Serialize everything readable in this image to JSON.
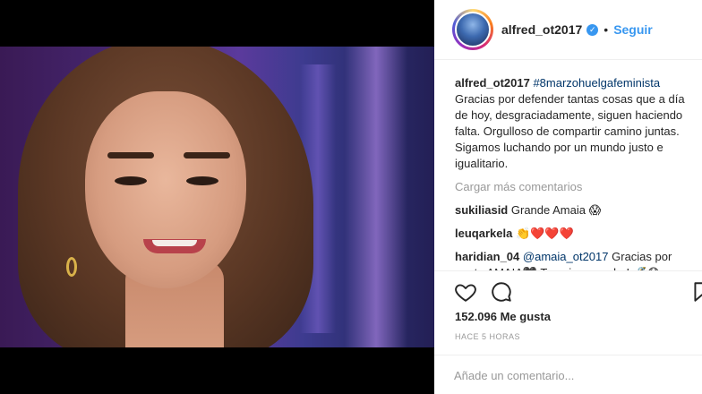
{
  "post": {
    "username": "alfred_ot2017",
    "verified_mark": "✓",
    "separator": "•",
    "follow_label": "Seguir",
    "caption_user": "alfred_ot2017",
    "caption_hashtag": "#8marzohuelgafeminista",
    "caption_text": "Gracias por defender tantas cosas que a día de hoy, desgraciadamente, siguen haciendo falta. Orgulloso de compartir camino juntas. Sigamos luchando por un mundo justo e igualitario.",
    "load_more": "Cargar más comentarios",
    "likes": "152.096 Me gusta",
    "time": "HACE 5 HORAS",
    "comment_placeholder": "Añade un comentario..."
  },
  "comments": [
    {
      "user": "sukiliasid",
      "text": "Grande Amaia 😱"
    },
    {
      "user": "leuqarkela",
      "text": "👏❤️❤️❤️"
    },
    {
      "user": "haridian_04",
      "mention": "@amaia_ot2017",
      "text": "Gracias por ser tu AMAIA🖤 Te quiero mucho! 🔏😱"
    }
  ],
  "icons": {
    "like": "heart-icon",
    "comment": "comment-icon",
    "save": "bookmark-icon"
  },
  "colors": {
    "link": "#3897f0",
    "muted": "#999999",
    "text": "#262626"
  }
}
